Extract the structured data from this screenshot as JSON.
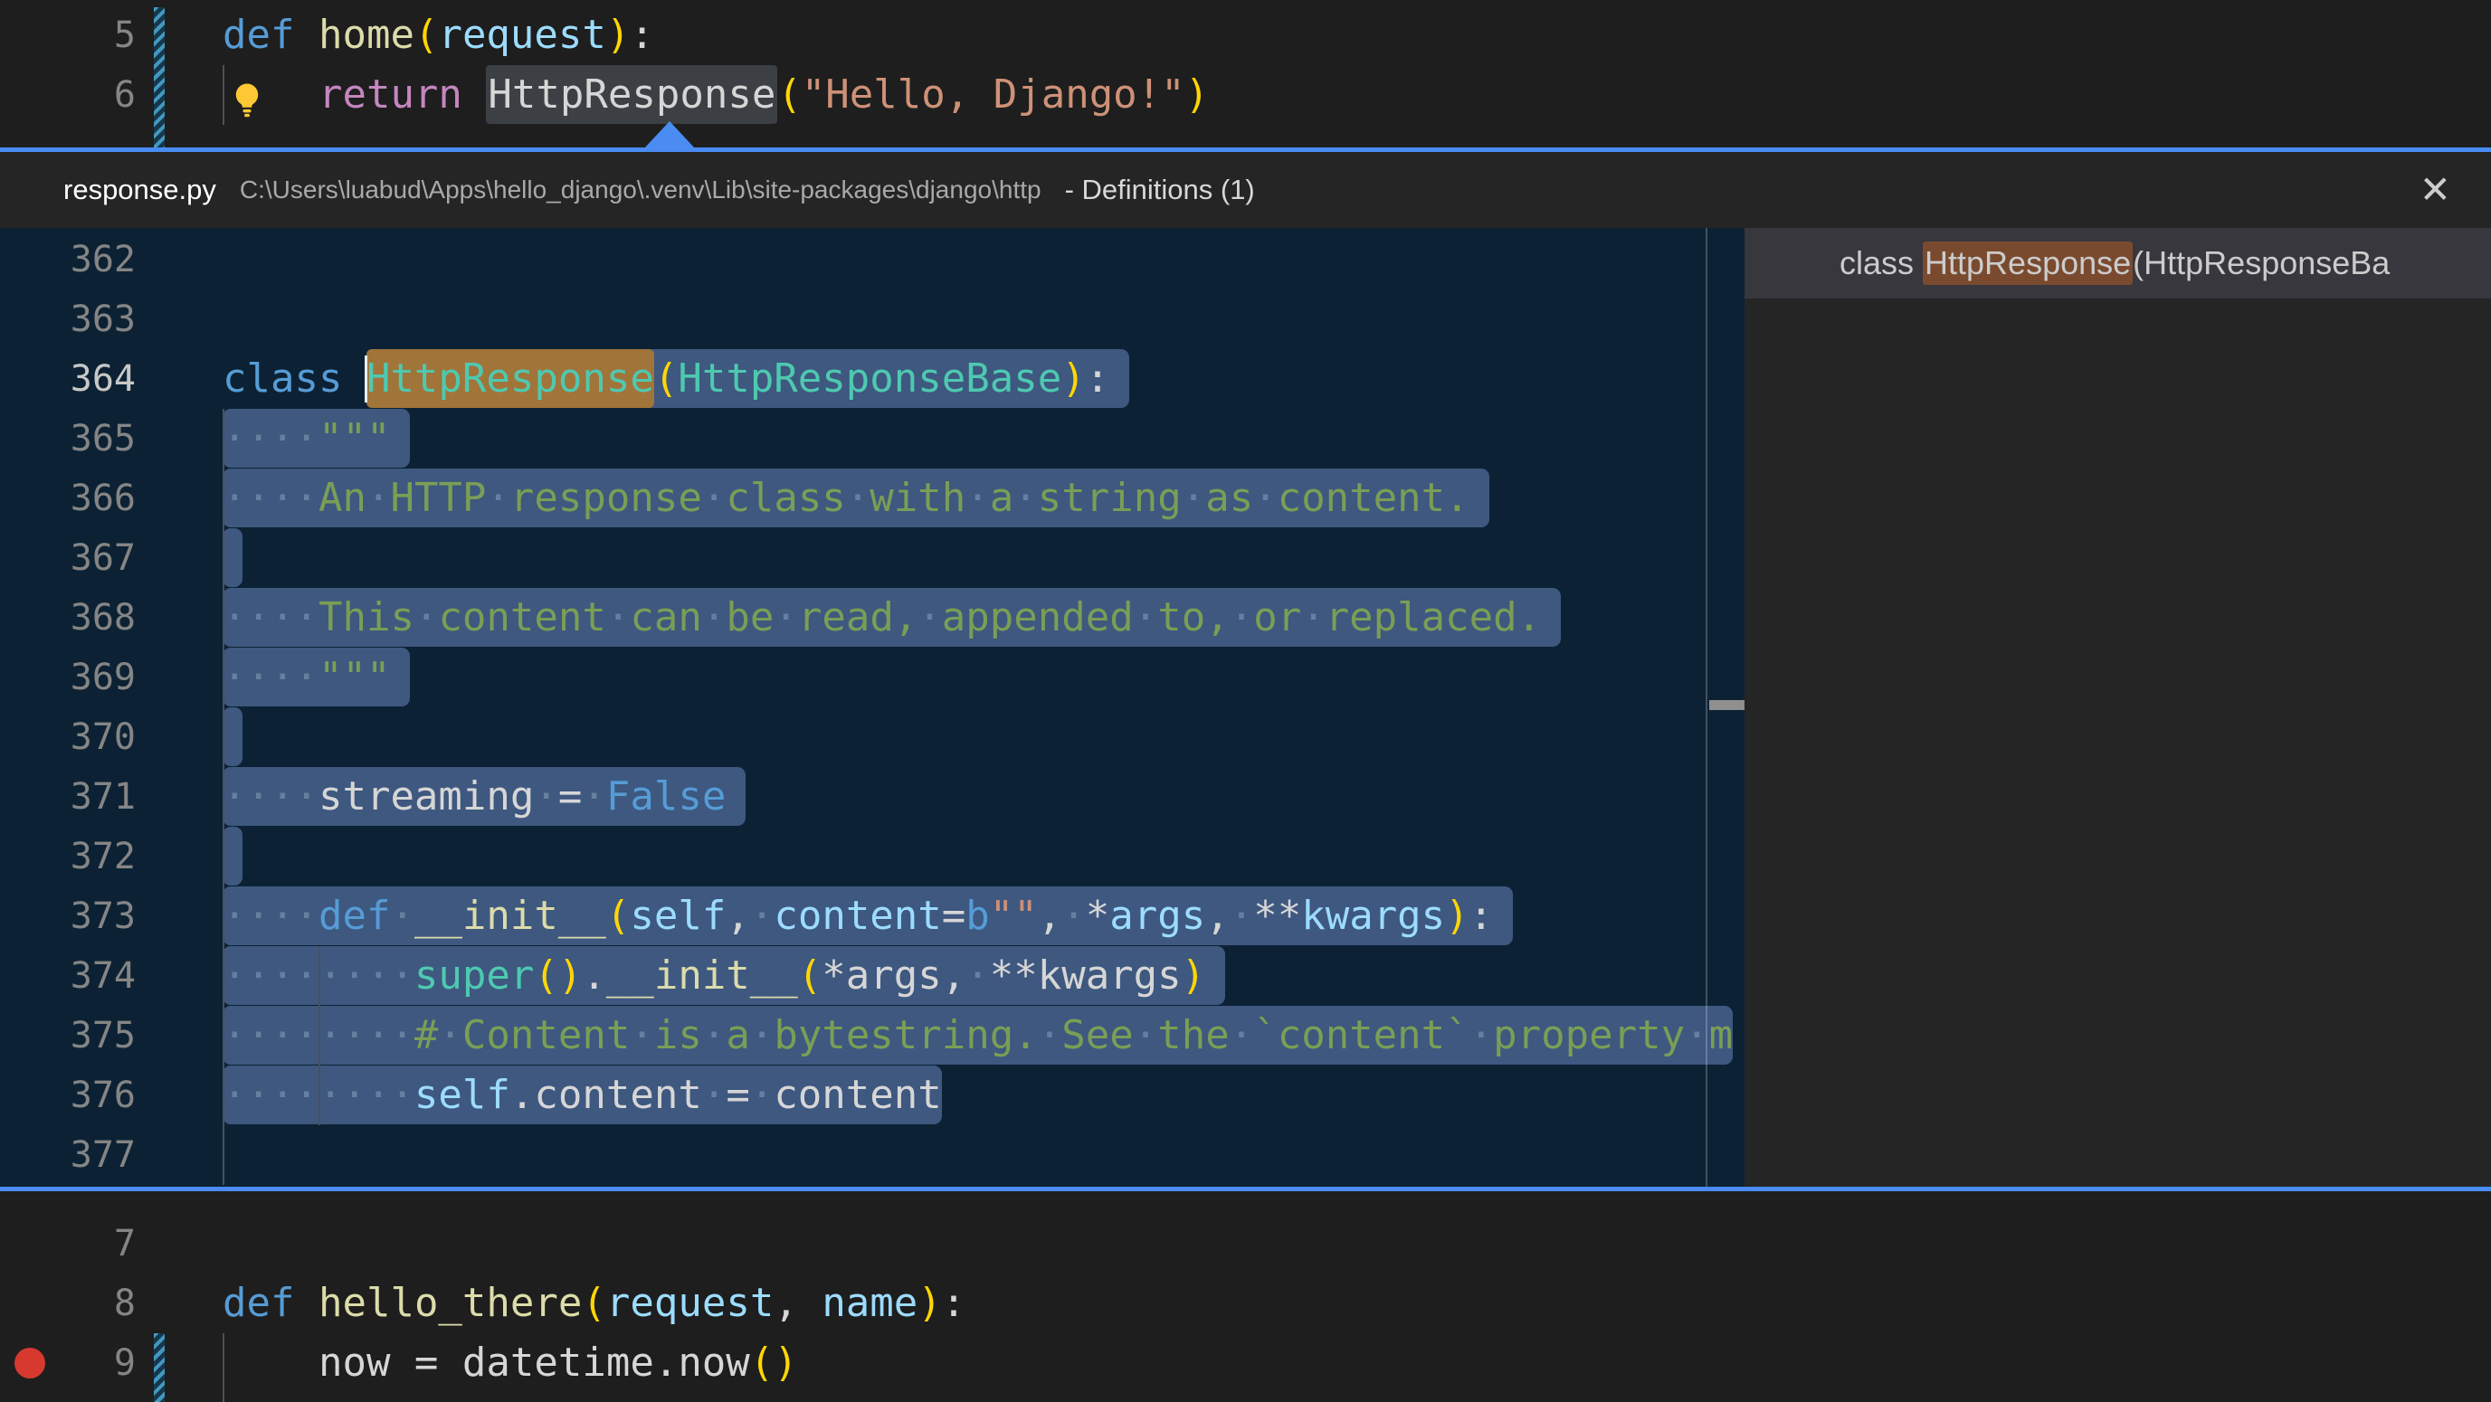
{
  "colors": {
    "bg": "#1e1e1e",
    "peek_bg": "#0c2234",
    "peek_border": "#4a8cf2",
    "header_bg": "#252526",
    "panel_bg": "#252526",
    "panel_row_bg": "#37373d",
    "sel": "#3e5880",
    "match": "#a1743a",
    "panel_match": "#7a4a2f",
    "word_hl": "#3c4044",
    "guide": "#4b5158",
    "ln": "#858585",
    "ln_active": "#c8c8c8",
    "red": "#d7392e",
    "stripe_a": "#4498c0",
    "stripe_b": "#16384c",
    "thumb": "#8f8f8f",
    "path_fg": "#a9a9a9",
    "bulb_color": "#fec834"
  },
  "syntax_colors": {
    "kw": "#569cd6",
    "ctrl": "#c586c0",
    "fn": "#dcdcaa",
    "cls": "#4ec9b0",
    "var": "#9cdcfe",
    "str": "#ce9178",
    "com": "#7a9e55",
    "txt": "#d6d6d6",
    "brk": "#ffd604",
    "dot": "#64809f"
  },
  "icons": {
    "lightbulb": "lightbulb-icon",
    "close": "close-icon",
    "breakpoint": "breakpoint-icon"
  },
  "top_editor": {
    "lines": [
      {
        "num": "5",
        "tokens": [
          {
            "t": "def",
            "c": "kw"
          },
          {
            "t": " ",
            "c": "txt"
          },
          {
            "t": "home",
            "c": "fn"
          },
          {
            "t": "(",
            "c": "brk"
          },
          {
            "t": "request",
            "c": "var"
          },
          {
            "t": ")",
            "c": "brk"
          },
          {
            "t": ":",
            "c": "txt"
          }
        ]
      },
      {
        "num": "6",
        "lightbulb": true,
        "guides": [
          0
        ],
        "word_highlight": [
          11,
          23
        ],
        "tokens": [
          {
            "t": "    ",
            "c": "txt"
          },
          {
            "t": "return",
            "c": "ctrl"
          },
          {
            "t": " ",
            "c": "txt"
          },
          {
            "t": "HttpResponse",
            "c": "txt"
          },
          {
            "t": "(",
            "c": "brk"
          },
          {
            "t": "\"Hello, Django!\"",
            "c": "str"
          },
          {
            "t": ")",
            "c": "brk"
          }
        ]
      }
    ]
  },
  "peek": {
    "header": {
      "filename": "response.py",
      "path": "C:\\Users\\luabud\\Apps\\hello_django\\.venv\\Lib\\site-packages\\django\\http",
      "meta": "- Definitions (1)",
      "close_glyph": "✕"
    },
    "editor": {
      "lines": [
        {
          "num": "362",
          "tokens": []
        },
        {
          "num": "363",
          "tokens": []
        },
        {
          "num": "364",
          "active": true,
          "sel": [
            6,
            37
          ],
          "nl": true,
          "match": [
            6,
            18
          ],
          "cursor_col": 6,
          "tokens": [
            {
              "t": "class",
              "c": "kw"
            },
            {
              "t": " ",
              "c": "txt"
            },
            {
              "t": "HttpResponse",
              "c": "cls"
            },
            {
              "t": "(",
              "c": "brk"
            },
            {
              "t": "HttpResponseBase",
              "c": "cls"
            },
            {
              "t": ")",
              "c": "brk"
            },
            {
              "t": ":",
              "c": "txt"
            }
          ]
        },
        {
          "num": "365",
          "guides": [
            0
          ],
          "sel": [
            0,
            7
          ],
          "nl": true,
          "tokens": [
            {
              "t": "    ",
              "c": "txt"
            },
            {
              "t": "\"\"\"",
              "c": "com"
            }
          ]
        },
        {
          "num": "366",
          "guides": [
            0
          ],
          "sel": [
            0,
            52
          ],
          "nl": true,
          "tokens": [
            {
              "t": "    ",
              "c": "txt"
            },
            {
              "t": "An HTTP response class with a string as content.",
              "c": "com"
            }
          ]
        },
        {
          "num": "367",
          "guides": [
            0
          ],
          "sel": [
            0,
            0
          ],
          "nl": true,
          "tokens": []
        },
        {
          "num": "368",
          "guides": [
            0
          ],
          "sel": [
            0,
            55
          ],
          "nl": true,
          "tokens": [
            {
              "t": "    ",
              "c": "txt"
            },
            {
              "t": "This content can be read, appended to, or replaced.",
              "c": "com"
            }
          ]
        },
        {
          "num": "369",
          "guides": [
            0
          ],
          "sel": [
            0,
            7
          ],
          "nl": true,
          "tokens": [
            {
              "t": "    ",
              "c": "txt"
            },
            {
              "t": "\"\"\"",
              "c": "com"
            }
          ]
        },
        {
          "num": "370",
          "guides": [
            0
          ],
          "sel": [
            0,
            0
          ],
          "nl": true,
          "tokens": []
        },
        {
          "num": "371",
          "guides": [
            0
          ],
          "sel": [
            0,
            21
          ],
          "nl": true,
          "tokens": [
            {
              "t": "    streaming = ",
              "c": "txt"
            },
            {
              "t": "False",
              "c": "kw"
            }
          ]
        },
        {
          "num": "372",
          "guides": [
            0
          ],
          "sel": [
            0,
            0
          ],
          "nl": true,
          "tokens": []
        },
        {
          "num": "373",
          "guides": [
            0
          ],
          "sel": [
            0,
            53
          ],
          "nl": true,
          "tokens": [
            {
              "t": "    ",
              "c": "txt"
            },
            {
              "t": "def",
              "c": "kw"
            },
            {
              "t": " ",
              "c": "txt"
            },
            {
              "t": "__init__",
              "c": "fn"
            },
            {
              "t": "(",
              "c": "brk"
            },
            {
              "t": "self",
              "c": "var"
            },
            {
              "t": ", ",
              "c": "txt"
            },
            {
              "t": "content",
              "c": "var"
            },
            {
              "t": "=",
              "c": "txt"
            },
            {
              "t": "b",
              "c": "kw"
            },
            {
              "t": "\"\"",
              "c": "str"
            },
            {
              "t": ", *",
              "c": "txt"
            },
            {
              "t": "args",
              "c": "var"
            },
            {
              "t": ", **",
              "c": "txt"
            },
            {
              "t": "kwargs",
              "c": "var"
            },
            {
              "t": ")",
              "c": "brk"
            },
            {
              "t": ":",
              "c": "txt"
            }
          ]
        },
        {
          "num": "374",
          "guides": [
            0,
            4
          ],
          "sel": [
            0,
            41
          ],
          "nl": true,
          "tokens": [
            {
              "t": "        ",
              "c": "txt"
            },
            {
              "t": "super",
              "c": "cls"
            },
            {
              "t": "()",
              "c": "brk"
            },
            {
              "t": ".",
              "c": "txt"
            },
            {
              "t": "__init__",
              "c": "fn"
            },
            {
              "t": "(",
              "c": "brk"
            },
            {
              "t": "*args, **kwargs",
              "c": "txt"
            },
            {
              "t": ")",
              "c": "brk"
            }
          ]
        },
        {
          "num": "375",
          "guides": [
            0,
            4
          ],
          "sel": [
            0,
            63
          ],
          "tokens": [
            {
              "t": "        ",
              "c": "txt"
            },
            {
              "t": "# Content is a bytestring. See the `content` property m",
              "c": "com"
            }
          ]
        },
        {
          "num": "376",
          "guides": [
            0,
            4
          ],
          "sel": [
            0,
            30
          ],
          "tokens": [
            {
              "t": "        ",
              "c": "txt"
            },
            {
              "t": "self",
              "c": "var"
            },
            {
              "t": ".content = content",
              "c": "txt"
            }
          ]
        },
        {
          "num": "377",
          "guides": [
            0
          ],
          "tokens": []
        }
      ]
    },
    "panel": {
      "result": {
        "prefix": "class ",
        "match": "HttpResponse",
        "suffix": "(HttpResponseBa"
      }
    }
  },
  "bottom_editor": {
    "lines": [
      {
        "num": "7",
        "tokens": []
      },
      {
        "num": "8",
        "tokens": [
          {
            "t": "def",
            "c": "kw"
          },
          {
            "t": " ",
            "c": "txt"
          },
          {
            "t": "hello_there",
            "c": "fn"
          },
          {
            "t": "(",
            "c": "brk"
          },
          {
            "t": "request",
            "c": "var"
          },
          {
            "t": ", ",
            "c": "txt"
          },
          {
            "t": "name",
            "c": "var"
          },
          {
            "t": ")",
            "c": "brk"
          },
          {
            "t": ":",
            "c": "txt"
          }
        ]
      },
      {
        "num": "9",
        "breakpoint": true,
        "guides": [
          0
        ],
        "tokens": [
          {
            "t": "    now = datetime.now",
            "c": "txt"
          },
          {
            "t": "()",
            "c": "brk"
          }
        ]
      }
    ]
  }
}
